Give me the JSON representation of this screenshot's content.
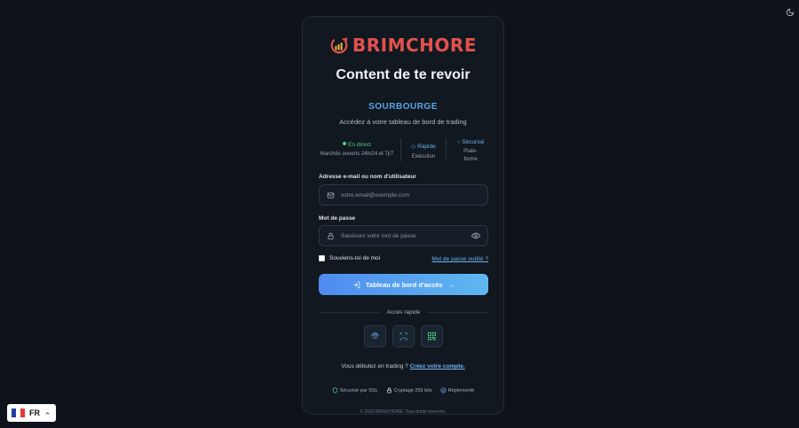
{
  "brand": {
    "name": "BRIMCHORE",
    "color": "#e2514d"
  },
  "card": {
    "title": "Content de te revoir",
    "subtitle": "SOURBOURGE",
    "tagline": "Accédez à votre tableau de bord de trading"
  },
  "features": [
    {
      "title": "En direct",
      "desc": "Marchés ouverts 24h/24 et 7j/7"
    },
    {
      "title": "Rapide",
      "desc": "Exécution"
    },
    {
      "title": "Sécurisé",
      "desc": "Plate-forme"
    }
  ],
  "form": {
    "email_label": "Adresse e-mail ou nom d'utilisateur",
    "email_placeholder": "votre.email@exemple.com",
    "password_label": "Mot de passe",
    "password_placeholder": "Saisissez votre mot de passe",
    "remember_label": "Souviens-toi de moi",
    "forgot_link": "Mot de passe oublié ?",
    "submit_label": "Tableau de bord d'accès"
  },
  "quick_access": {
    "label": "Accès rapide",
    "buttons": [
      "fingerprint-icon",
      "face-id-icon",
      "qr-code-icon"
    ]
  },
  "signup": {
    "prompt": "Vous débutez en trading ?",
    "link": "Créez votre compte."
  },
  "badges": [
    "Sécurisé par SSL",
    "Cryptage 256 bits",
    "Réglementé"
  ],
  "footer": {
    "copyright": "© 2026 BRIMCHORE. Tous droits réservés."
  },
  "language": {
    "code": "FR"
  },
  "colors": {
    "accent": "#5aa4e6",
    "background": "#0e131b",
    "success": "#4fcf7e"
  }
}
